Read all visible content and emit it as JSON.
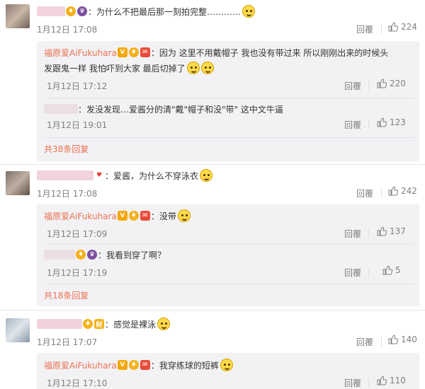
{
  "colors": {
    "name": "#eb7350",
    "meta": "#808080",
    "sub_bg": "#f2f2f5"
  },
  "comments": [
    {
      "text": "：为什么不把最后那一刻拍完整…………",
      "time": "1月12日 17:08",
      "reply": "回覆",
      "likes": "224",
      "subs": [
        {
          "name": "福原爱AiFukuhara",
          "text1": "：因为 这里不用戴帽子 我也没有带过来 所以刚刚出来的时候头",
          "text2": "发跟鬼一样 我怕吓到大家 最后切掉了",
          "time": "1月12日 17:12",
          "reply": "回覆",
          "likes": "220"
        },
        {
          "text": "：发没发现…爱酱分的清\"戴\"帽子和没\"带\" 这中文牛逼",
          "time": "1月12日 19:01",
          "reply": "回覆",
          "likes": "123"
        }
      ],
      "more": "共38条回复"
    },
    {
      "text": "：爱酱，为什么不穿泳衣",
      "time": "1月12日 17:08",
      "reply": "回覆",
      "likes": "242",
      "subs": [
        {
          "name": "福原爱AiFukuhara",
          "text": "：没带",
          "time": "1月12日 17:09",
          "reply": "回覆",
          "likes": "137"
        },
        {
          "text": "：我看到穿了啊？",
          "time": "1月12日 17:19",
          "reply": "回覆",
          "likes": "5"
        }
      ],
      "more": "共18条回复"
    },
    {
      "text": "：感觉是裸泳",
      "time": "1月12日 17:07",
      "reply": "回覆",
      "likes": "140",
      "subs": [
        {
          "name": "福原爱AiFukuhara",
          "text": "：我穿练球的短裤",
          "time": "1月12日 17:10",
          "reply": "回覆",
          "likes": "110"
        }
      ]
    }
  ]
}
